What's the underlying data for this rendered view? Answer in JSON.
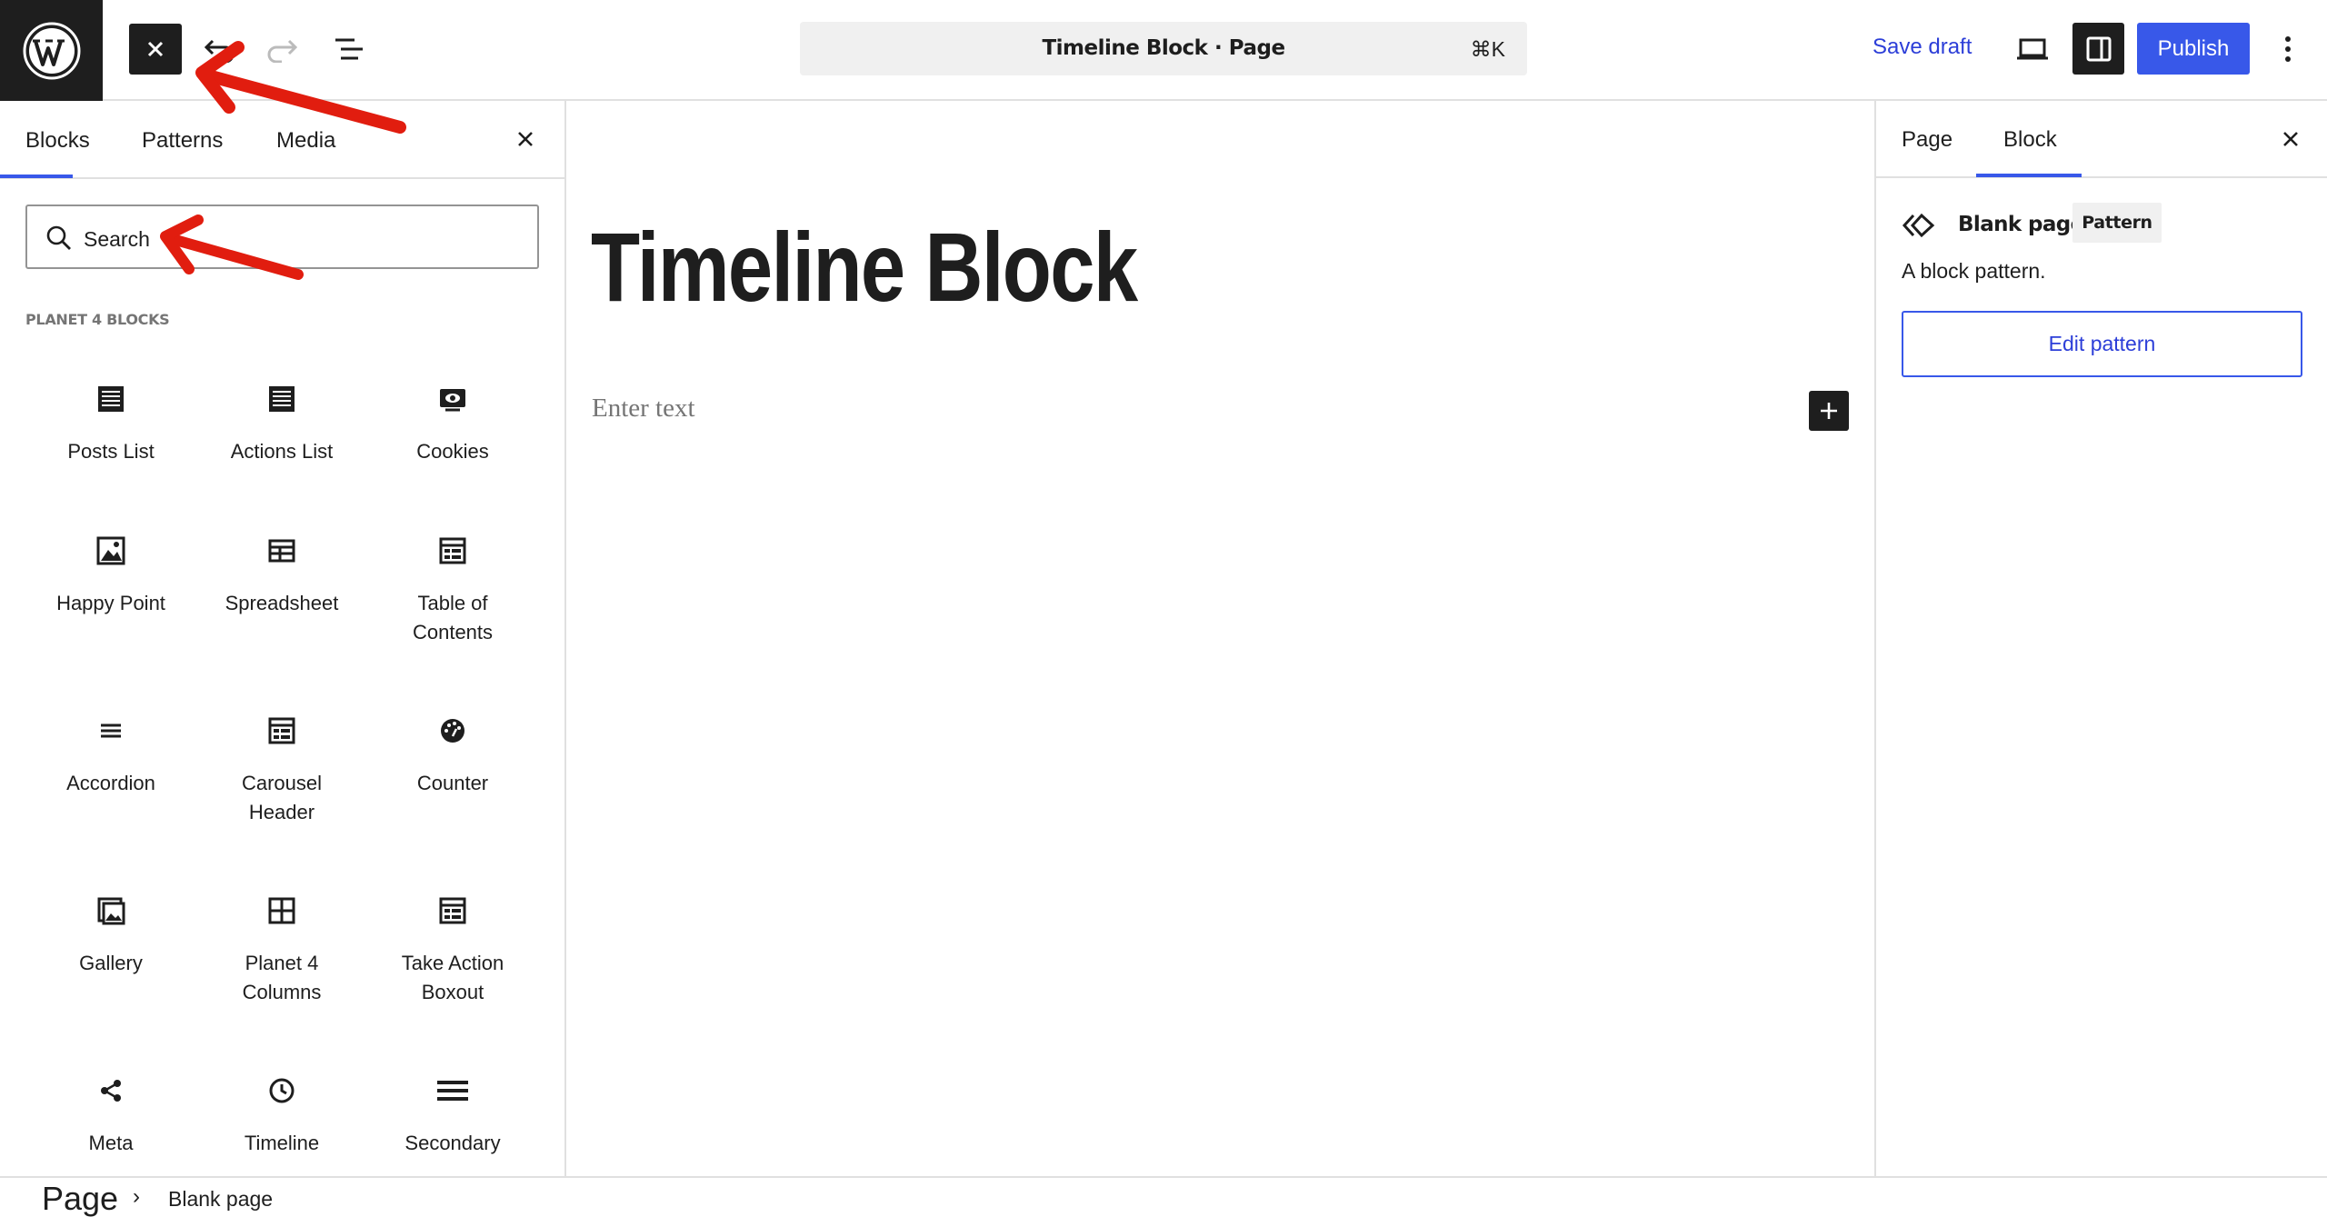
{
  "topbar": {
    "document_title": "Timeline Block · Page",
    "shortcut": "⌘K",
    "save_draft_label": "Save draft",
    "publish_label": "Publish",
    "icons": [
      "wordpress-logo",
      "close-icon",
      "undo-icon",
      "redo-icon",
      "document-overview-icon",
      "desktop-preview-icon",
      "settings-sidebar-icon",
      "more-options-icon"
    ]
  },
  "inserter": {
    "tabs": [
      "Blocks",
      "Patterns",
      "Media"
    ],
    "active_tab": "Blocks",
    "search_placeholder": "Search",
    "category_heading": "PLANET 4 BLOCKS",
    "blocks": [
      {
        "label": "Posts List",
        "icon": "posts-list-icon"
      },
      {
        "label": "Actions List",
        "icon": "actions-list-icon"
      },
      {
        "label": "Cookies",
        "icon": "cookies-icon"
      },
      {
        "label": "Happy Point",
        "icon": "image-icon"
      },
      {
        "label": "Spreadsheet",
        "icon": "spreadsheet-icon"
      },
      {
        "label": "Table of Contents",
        "icon": "table-of-contents-icon"
      },
      {
        "label": "Accordion",
        "icon": "accordion-icon"
      },
      {
        "label": "Carousel Header",
        "icon": "carousel-header-icon"
      },
      {
        "label": "Counter",
        "icon": "counter-icon"
      },
      {
        "label": "Gallery",
        "icon": "gallery-icon"
      },
      {
        "label": "Planet 4 Columns",
        "icon": "columns-icon"
      },
      {
        "label": "Take Action Boxout",
        "icon": "take-action-icon"
      },
      {
        "label": "Meta",
        "icon": "share-icon"
      },
      {
        "label": "Timeline",
        "icon": "clock-icon"
      },
      {
        "label": "Secondary",
        "icon": "menu-icon"
      }
    ]
  },
  "canvas": {
    "title": "Timeline Block",
    "placeholder": "Enter text"
  },
  "sidebar": {
    "tabs": [
      "Page",
      "Block"
    ],
    "active_tab": "Block",
    "pattern_title": "Blank page",
    "pattern_badge": "Pattern",
    "pattern_description": "A block pattern.",
    "edit_button": "Edit pattern"
  },
  "breadcrumb": {
    "root": "Page",
    "separator": "›",
    "current": "Blank page"
  },
  "colors": {
    "accent": "#3858e9",
    "dark": "#1e1e1e",
    "annotation": "#e11d0f"
  }
}
